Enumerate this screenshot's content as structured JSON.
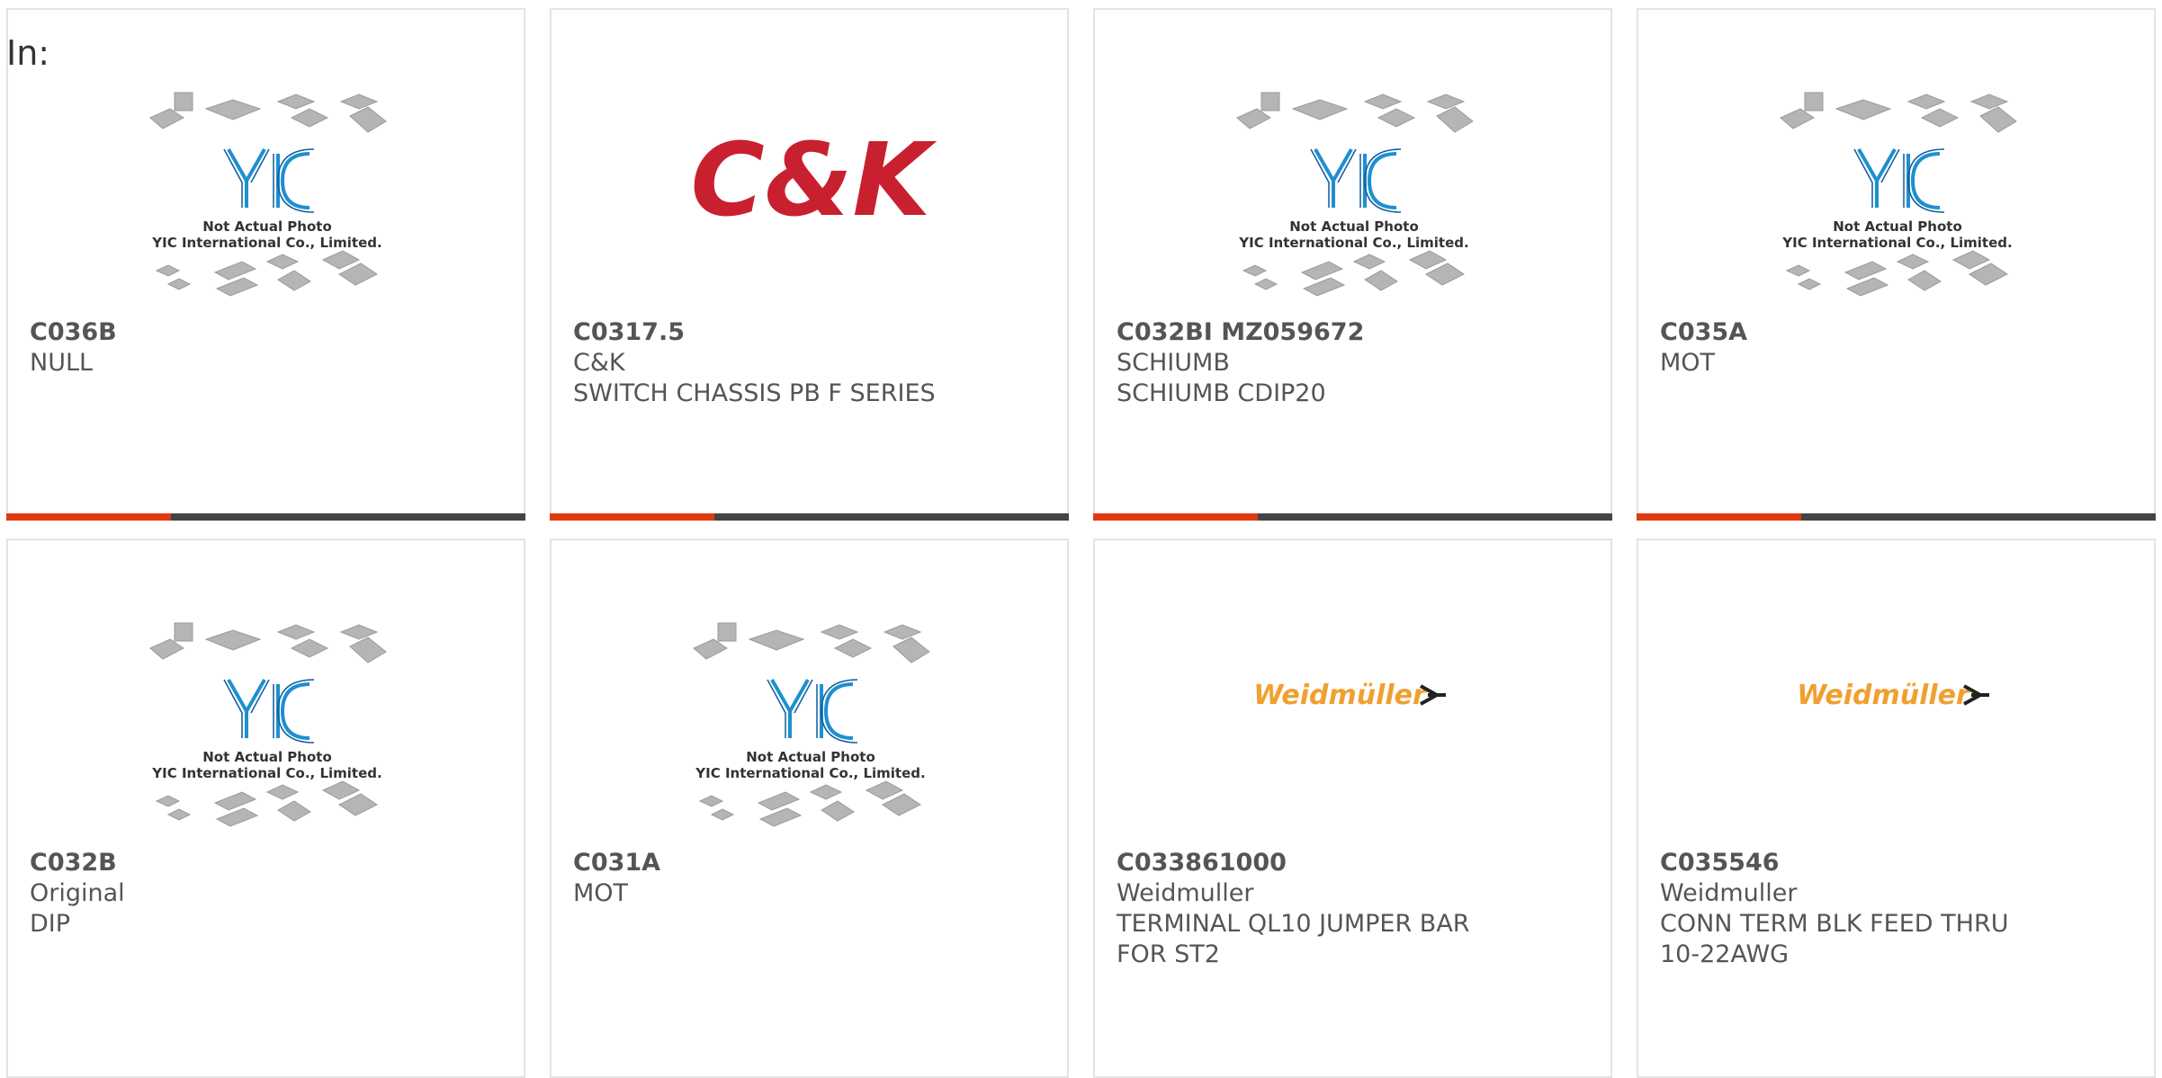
{
  "header": {
    "in_label": "In:"
  },
  "colors": {
    "accent": "#e03a10",
    "bar": "#444444",
    "yic_blue": "#1e8fd0",
    "ck_red": "#c8202f",
    "weidmuller_orange": "#f0a030"
  },
  "placeholder": {
    "line1": "Not Actual Photo",
    "line2": "YIC International Co., Limited."
  },
  "logos": {
    "ck": "C&K",
    "weidmuller": "Weidmüller"
  },
  "products": [
    {
      "part": "C036B",
      "maker": "NULL",
      "desc": "",
      "image": "yic-placeholder"
    },
    {
      "part": "C0317.5",
      "maker": "C&K",
      "desc": "SWITCH CHASSIS PB F SERIES",
      "image": "ck-logo"
    },
    {
      "part": "C032BI MZ059672",
      "maker": "SCHIUMB",
      "desc": "SCHIUMB CDIP20",
      "image": "yic-placeholder"
    },
    {
      "part": "C035A",
      "maker": "MOT",
      "desc": "",
      "image": "yic-placeholder"
    },
    {
      "part": "C032B",
      "maker": "Original",
      "desc": "DIP",
      "image": "yic-placeholder"
    },
    {
      "part": "C031A",
      "maker": "MOT",
      "desc": "",
      "image": "yic-placeholder"
    },
    {
      "part": "C033861000",
      "maker": "Weidmuller",
      "desc": "TERMINAL QL10 JUMPER BAR FOR ST2",
      "image": "weidmuller-logo"
    },
    {
      "part": "C035546",
      "maker": "Weidmuller",
      "desc": "CONN TERM BLK FEED THRU 10-22AWG",
      "image": "weidmuller-logo"
    }
  ]
}
